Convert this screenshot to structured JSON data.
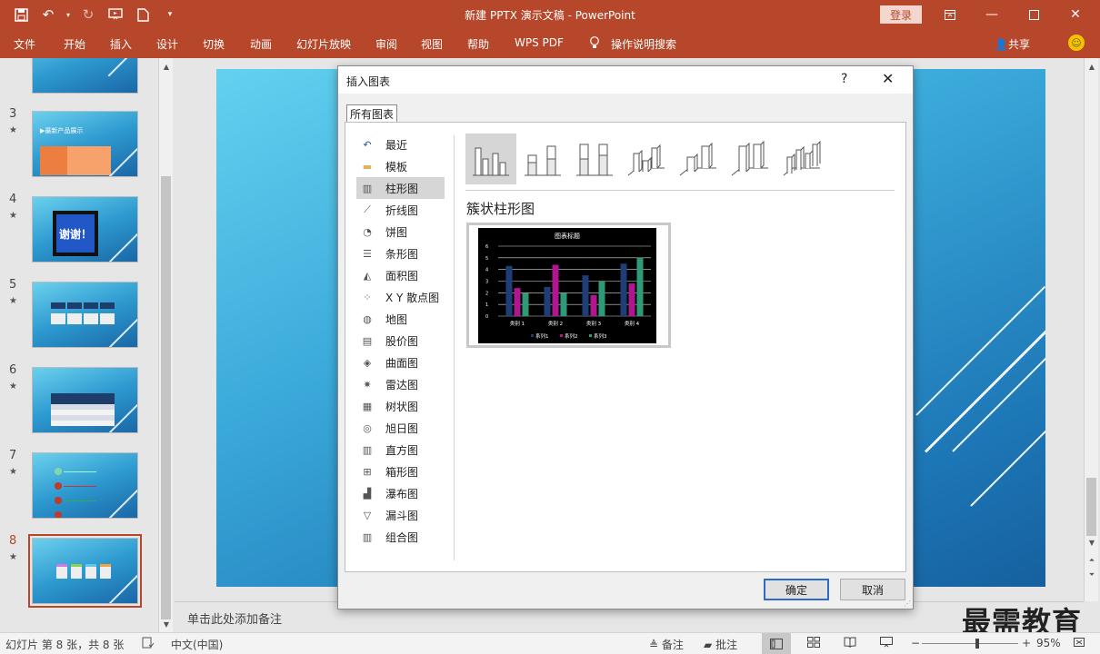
{
  "titlebar": {
    "title": "新建 PPTX 演示文稿  -  PowerPoint",
    "login": "登录"
  },
  "ribbon": {
    "tabs": [
      "文件",
      "开始",
      "插入",
      "设计",
      "切换",
      "动画",
      "幻灯片放映",
      "审阅",
      "视图",
      "帮助",
      "WPS PDF"
    ],
    "tell_me": "操作说明搜索",
    "share": "共享"
  },
  "thumbnails": {
    "slides": [
      {
        "num": "3",
        "star": "★",
        "text": "▶最新产品展示"
      },
      {
        "num": "4",
        "star": "★",
        "text": "谢谢！"
      },
      {
        "num": "5",
        "star": "★",
        "text": ""
      },
      {
        "num": "6",
        "star": "★",
        "text": ""
      },
      {
        "num": "7",
        "star": "★",
        "text": ""
      },
      {
        "num": "8",
        "star": "★",
        "text": ""
      }
    ],
    "selected": "8"
  },
  "notes": {
    "placeholder": "单击此处添加备注"
  },
  "watermark": "最需教育",
  "status": {
    "slide_info": "幻灯片 第 8 张，共 8 张",
    "language": "中文(中国)",
    "notes": "备注",
    "comments": "批注",
    "zoom": "95%",
    "zoom_level": 0.58
  },
  "dialog": {
    "title": "插入图表",
    "help": "?",
    "tab": "所有图表",
    "categories": [
      "最近",
      "模板",
      "柱形图",
      "折线图",
      "饼图",
      "条形图",
      "面积图",
      "X Y 散点图",
      "地图",
      "股价图",
      "曲面图",
      "雷达图",
      "树状图",
      "旭日图",
      "直方图",
      "箱形图",
      "瀑布图",
      "漏斗图",
      "组合图"
    ],
    "selected_category": "柱形图",
    "selected_subtype_name": "簇状柱形图",
    "ok": "确定",
    "cancel": "取消"
  },
  "chart_data": {
    "type": "bar",
    "title": "图表标题",
    "categories": [
      "类别 1",
      "类别 2",
      "类别 3",
      "类别 4"
    ],
    "series": [
      {
        "name": "系列1",
        "values": [
          4.3,
          2.5,
          3.5,
          4.5
        ],
        "color": "#1f3e78"
      },
      {
        "name": "系列2",
        "values": [
          2.4,
          4.4,
          1.8,
          2.8
        ],
        "color": "#b0178e"
      },
      {
        "name": "系列3",
        "values": [
          2,
          2,
          3,
          5
        ],
        "color": "#2e9a78"
      }
    ],
    "ylim": [
      0,
      6
    ],
    "yticks": [
      0,
      1,
      2,
      3,
      4,
      5,
      6
    ],
    "grid": true,
    "legend": "bottom"
  }
}
